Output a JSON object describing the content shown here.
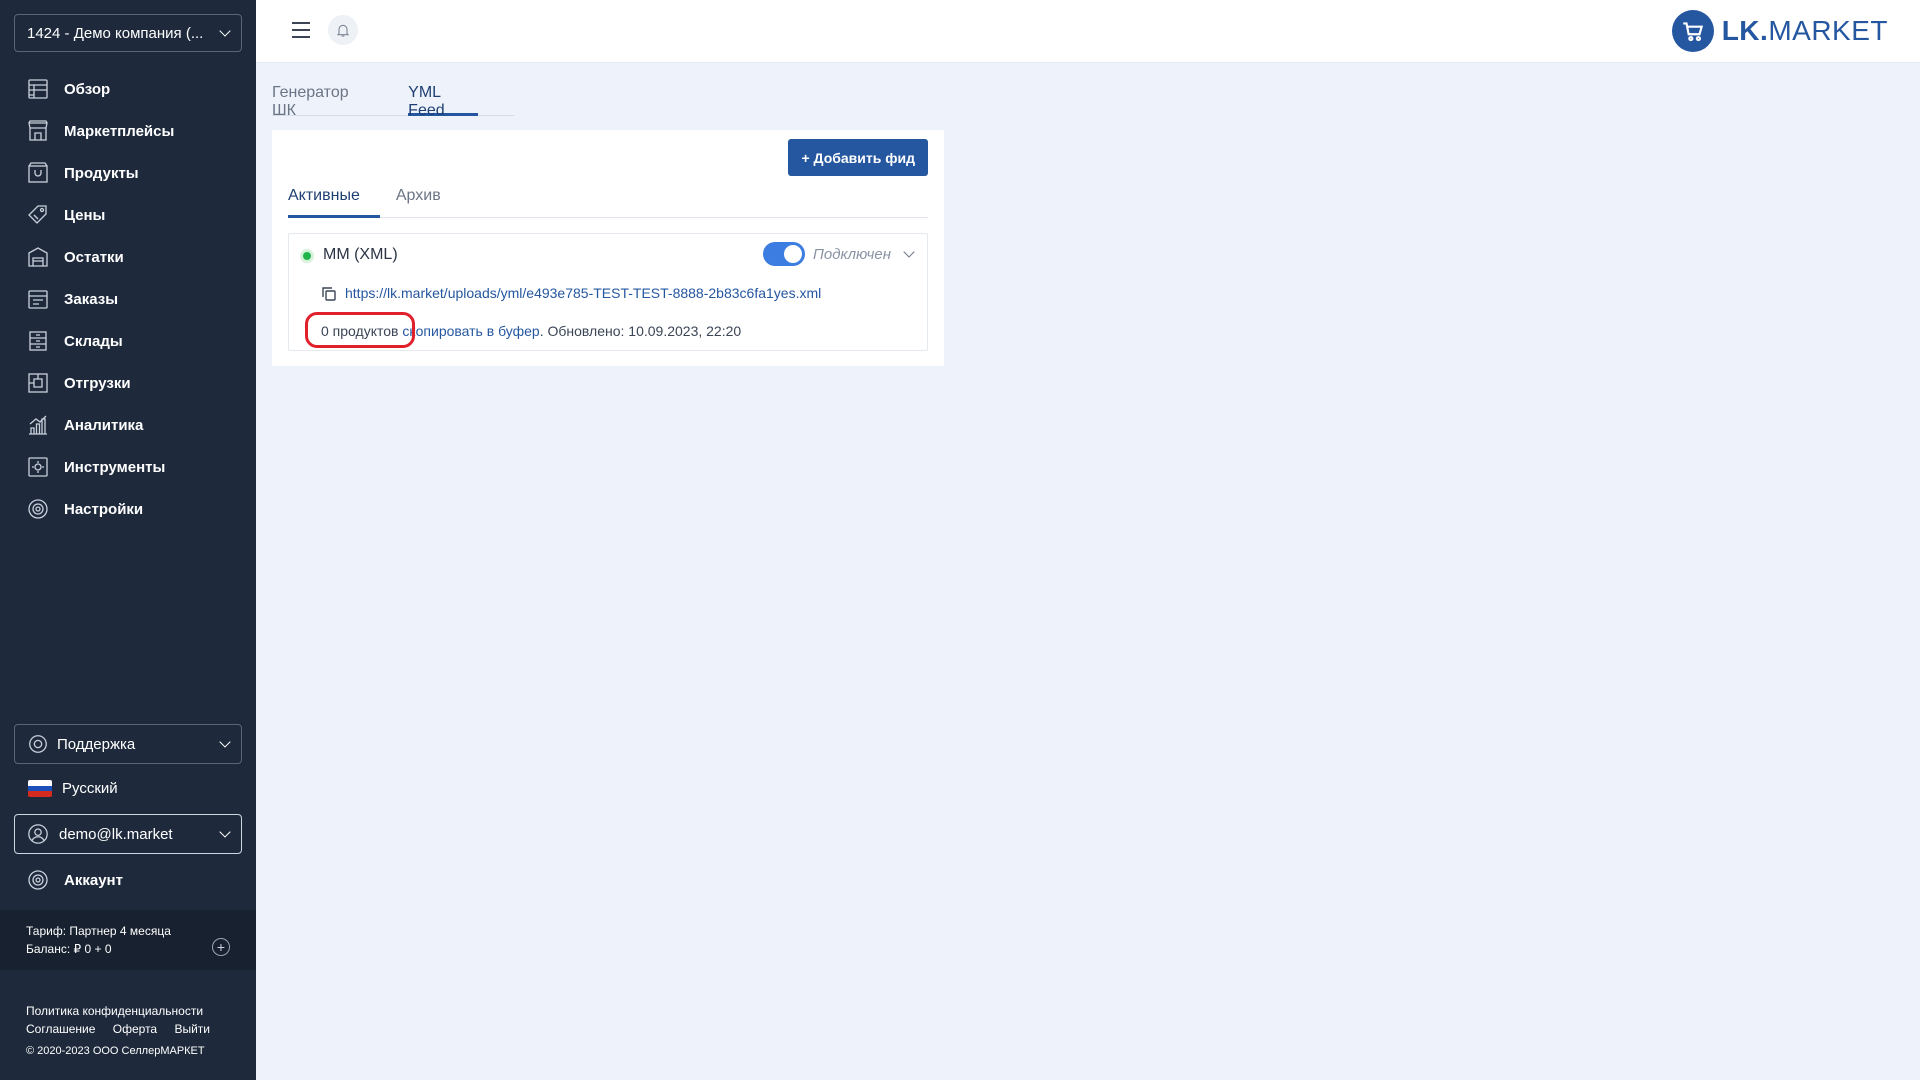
{
  "sidebar": {
    "company": "1424 - Демо компания (...",
    "nav": [
      {
        "label": "Обзор",
        "icon": "overview-icon"
      },
      {
        "label": "Маркетплейсы",
        "icon": "marketplace-icon"
      },
      {
        "label": "Продукты",
        "icon": "products-icon"
      },
      {
        "label": "Цены",
        "icon": "price-tag-icon"
      },
      {
        "label": "Остатки",
        "icon": "stock-icon"
      },
      {
        "label": "Заказы",
        "icon": "orders-icon"
      },
      {
        "label": "Склады",
        "icon": "warehouse-icon"
      },
      {
        "label": "Отгрузки",
        "icon": "shipments-icon"
      },
      {
        "label": "Аналитика",
        "icon": "analytics-icon"
      },
      {
        "label": "Инструменты",
        "icon": "tools-icon"
      },
      {
        "label": "Настройки",
        "icon": "settings-icon"
      }
    ],
    "support": "Поддержка",
    "language": "Русский",
    "user_email": "demo@lk.market",
    "account": "Аккаунт",
    "tariff": "Тариф: Партнер 4 месяца",
    "balance": "Баланс: ₽ 0 + 0",
    "footer": {
      "privacy": "Политика конфиденциальности",
      "agreement": "Соглашение",
      "offer": "Оферта",
      "logout": "Выйти",
      "copyright": "© 2020-2023 ООО СеллерМАРКЕТ"
    }
  },
  "header": {
    "logo_bold": "LK.",
    "logo_rest": "MARKET"
  },
  "tabs": [
    "Генератор ШК",
    "YML Feed"
  ],
  "card": {
    "add_button": "+ Добавить фид",
    "subtabs": [
      "Активные",
      "Архив"
    ],
    "feed": {
      "name": "MM (XML)",
      "status": "Подключен",
      "url": "https://lk.market/uploads/yml/e493e785-TEST-TEST-8888-2b83c6fa1yes.xml",
      "products": "0 продуктов",
      "copy_link": "скопировать в буфер",
      "updated": ". Обновлено: 10.09.2023, 22:20"
    }
  },
  "colors": {
    "sidebar_bg": "#1e2a3c",
    "accent": "#2557a0",
    "toggle_on": "#3b7de0",
    "status_green": "#20b54a",
    "highlight_red": "#e0202a"
  }
}
